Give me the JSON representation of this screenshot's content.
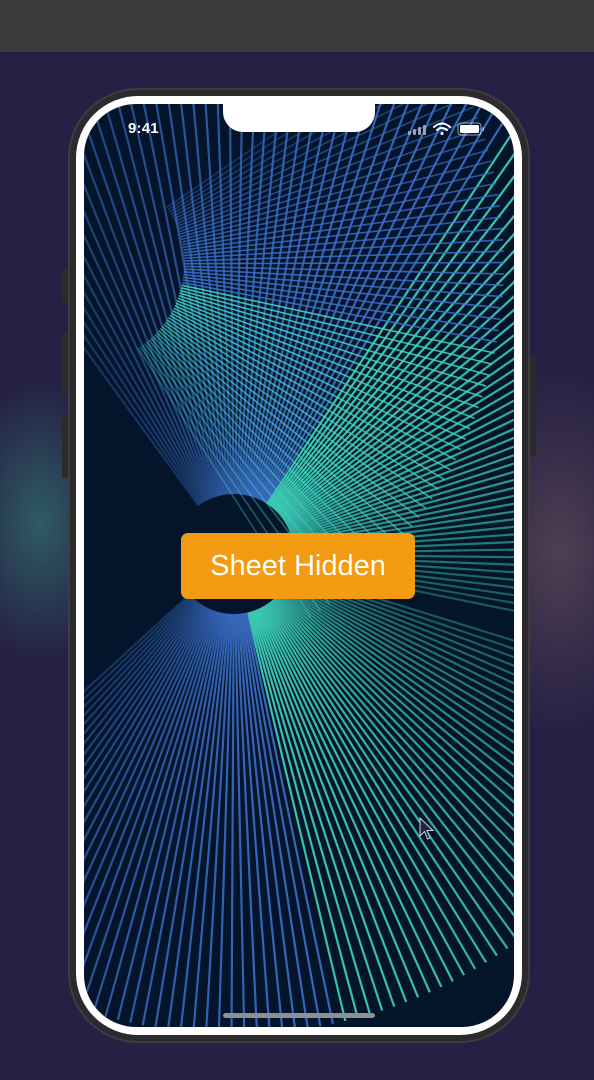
{
  "status_bar": {
    "time": "9:41",
    "icons": [
      "cellular-icon",
      "wifi-icon",
      "battery-icon"
    ]
  },
  "main": {
    "button_label": "Sheet Hidden"
  },
  "colors": {
    "accent": "#f39b12",
    "wallpaper_teal": "#3fd6c0",
    "wallpaper_blue": "#3b6fc8",
    "background": "#262144"
  }
}
